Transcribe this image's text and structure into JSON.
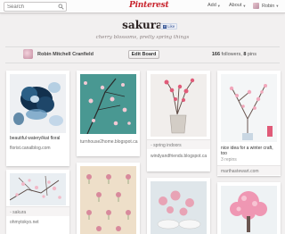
{
  "topbar": {
    "search_placeholder": "Search",
    "logo": "Pinterest",
    "add_label": "Add",
    "about_label": "About",
    "user_label": "Robin"
  },
  "board": {
    "title": "sakura",
    "like_label": "Like",
    "description": "cherry blossoms, pretty spring things",
    "owner": "Robin Mitchell Cranfield",
    "edit_label": "Edit Board",
    "followers": "166",
    "followers_label": "followers,",
    "pins": "8",
    "pins_label": "pins"
  },
  "pins": [
    {
      "caption": "beautiful watery/ikat floral",
      "source": "florist.canalblog.com"
    },
    {
      "caption": "",
      "source": "turnhouse2home.blogspot.ca"
    },
    {
      "caption": "spring indoors",
      "source": "windyandfriends.blogspot.ca"
    },
    {
      "caption": "nice idea for a winter craft, too",
      "repins": "3 repins",
      "source": "marthastewart.com"
    },
    {
      "caption": "sakura",
      "source": "ohmytokyo.net"
    }
  ],
  "colors": {
    "brand": "#c8232c",
    "background": "#f2f0f0",
    "cherry_pink": "#e98aa6"
  }
}
